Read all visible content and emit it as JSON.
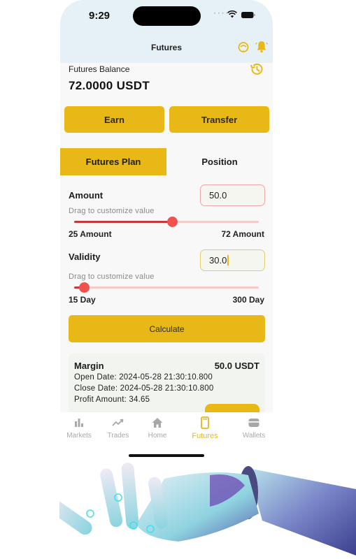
{
  "status_bar": {
    "time": "9:29"
  },
  "header": {
    "title": "Futures"
  },
  "balance": {
    "label": "Futures Balance",
    "value": "72.0000 USDT"
  },
  "actions": {
    "earn_label": "Earn",
    "transfer_label": "Transfer"
  },
  "tabs": [
    {
      "label": "Futures Plan",
      "active": true
    },
    {
      "label": "Position",
      "active": false
    }
  ],
  "amount": {
    "label": "Amount",
    "value": "50.0",
    "hint": "Drag to customize value",
    "min_label": "25 Amount",
    "max_label": "72 Amount",
    "min": 25,
    "max": 72,
    "slider_value": 50
  },
  "validity": {
    "label": "Validity",
    "value": "30.0",
    "hint": "Drag to customize value",
    "min_label": "15 Day",
    "max_label": "300 Day",
    "min": 15,
    "max": 300,
    "slider_value": 30
  },
  "calculate_label": "Calculate",
  "margin_card": {
    "title": "Margin",
    "value": "50.0 USDT",
    "open_date": "Open Date: 2024-05-28 21:30:10.800",
    "close_date": "Close Date: 2024-05-28 21:30:10.800",
    "profit": "Profit Amount: 34.65"
  },
  "bottom_nav": [
    {
      "label": "Markets",
      "icon": "bar-chart-icon",
      "active": false
    },
    {
      "label": "Trades",
      "icon": "trend-icon",
      "active": false
    },
    {
      "label": "Home",
      "icon": "home-icon",
      "active": false
    },
    {
      "label": "Futures",
      "icon": "phone-icon",
      "active": true
    },
    {
      "label": "Wallets",
      "icon": "wallet-icon",
      "active": false
    }
  ],
  "colors": {
    "accent": "#e8b817",
    "header_bg": "#e6f1f7",
    "slider_active": "#c33a3a",
    "slider_thumb": "#ef5350",
    "slider_inactive": "#f7caca"
  }
}
